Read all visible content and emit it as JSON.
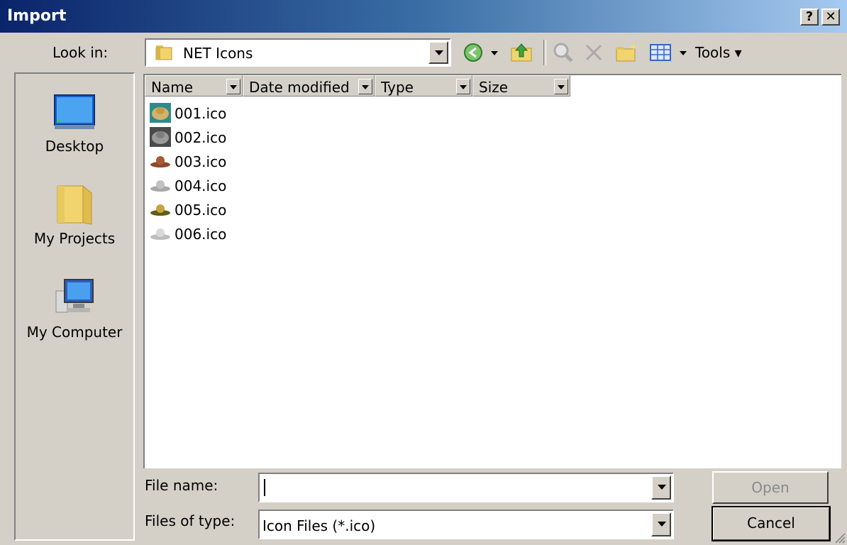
{
  "window": {
    "title": "Import",
    "help_label": "?",
    "close_label": "✕"
  },
  "lookin": {
    "label": "Look in:",
    "value": "NET Icons"
  },
  "toolbar": {
    "icons": [
      "back-icon",
      "up-folder-icon",
      "search-web-icon",
      "delete-icon",
      "new-folder-icon",
      "views-icon"
    ],
    "tools_label": "Tools ▾"
  },
  "places": [
    {
      "label": "Desktop",
      "icon": "desktop-icon"
    },
    {
      "label": "My Projects",
      "icon": "folder-icon"
    },
    {
      "label": "My Computer",
      "icon": "computer-icon"
    }
  ],
  "columns": [
    "Name",
    "Date modified",
    "Type",
    "Size"
  ],
  "files": [
    {
      "name": "001.ico",
      "icon": "cowboy-hat-icon",
      "color": "#c8a45a"
    },
    {
      "name": "002.ico",
      "icon": "cowboy-hat-icon",
      "color": "#8c8c8c"
    },
    {
      "name": "003.ico",
      "icon": "hat-icon",
      "color": "#8b4a2b"
    },
    {
      "name": "004.ico",
      "icon": "hat-icon",
      "color": "#a8a8a8"
    },
    {
      "name": "005.ico",
      "icon": "hat-icon",
      "color": "#6b6b1f"
    },
    {
      "name": "006.ico",
      "icon": "hat-icon",
      "color": "#bdbdbd"
    }
  ],
  "form": {
    "file_name_label": "File name:",
    "file_name_value": "",
    "file_type_label": "Files of type:",
    "file_type_value": "Icon Files (*.ico)"
  },
  "buttons": {
    "open": "Open",
    "cancel": "Cancel"
  }
}
